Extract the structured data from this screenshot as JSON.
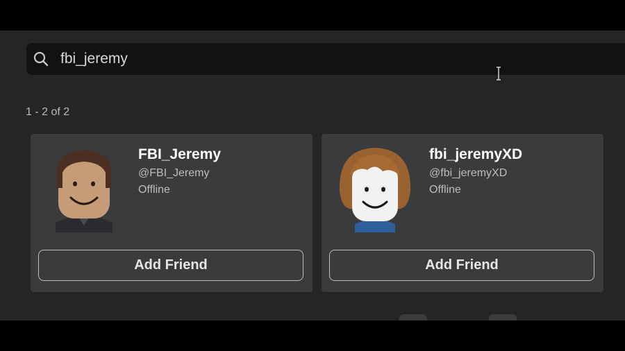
{
  "search": {
    "value": "fbi_jeremy"
  },
  "results": {
    "count_text": "1 - 2 of 2",
    "items": [
      {
        "display_name": "FBI_Jeremy",
        "username": "@FBI_Jeremy",
        "status": "Offline",
        "button": "Add Friend"
      },
      {
        "display_name": "fbi_jeremyXD",
        "username": "@fbi_jeremyXD",
        "status": "Offline",
        "button": "Add Friend"
      }
    ]
  },
  "icons": {
    "search": "search-icon",
    "cursor": "text-cursor-icon"
  },
  "colors": {
    "background": "#232527",
    "card": "#393b3d",
    "search_bg": "#121215",
    "text_primary": "#ffffff",
    "text_secondary": "#bdbebe"
  }
}
